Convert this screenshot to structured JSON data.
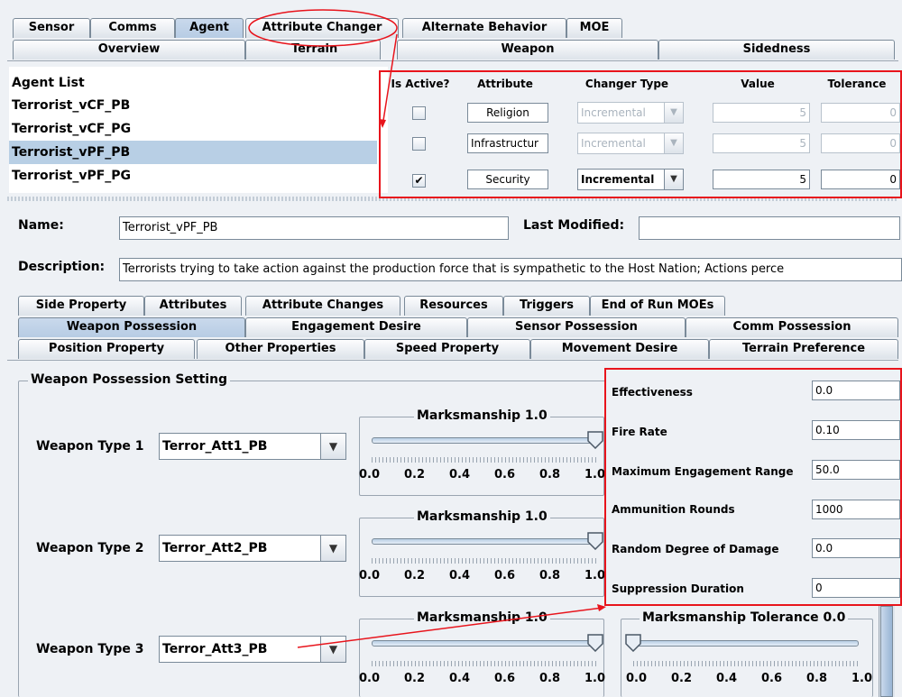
{
  "top_tabs": [
    "Sensor",
    "Comms",
    "Agent",
    "Attribute Changer",
    "Alternate Behavior",
    "MOE"
  ],
  "second_tabs": [
    "Overview",
    "Terrain",
    "Weapon",
    "Sidedness"
  ],
  "agent_list": {
    "header": "Agent List",
    "items": [
      "Terrorist_vCF_PB",
      "Terrorist_vCF_PG",
      "Terrorist_vPF_PB",
      "Terrorist_vPF_PG"
    ],
    "selected_index": 2
  },
  "attr_table": {
    "headers": [
      "Is Active?",
      "Attribute",
      "Changer Type",
      "Value",
      "Tolerance"
    ],
    "rows": [
      {
        "active": false,
        "attribute": "Religion",
        "changer": "Incremental",
        "value": "5",
        "tolerance": "0",
        "enabled": false
      },
      {
        "active": false,
        "attribute": "Infrastructur",
        "changer": "Incremental",
        "value": "5",
        "tolerance": "0",
        "enabled": false
      },
      {
        "active": true,
        "attribute": "Security",
        "changer": "Incremental",
        "value": "5",
        "tolerance": "0",
        "enabled": true
      }
    ]
  },
  "form": {
    "name_label": "Name:",
    "name_value": "Terrorist_vPF_PB",
    "modified_label": "Last Modified:",
    "modified_value": "",
    "desc_label": "Description:",
    "desc_value": "Terrorists trying to take action against the production force that is sympathetic to the Host Nation; Actions perce"
  },
  "sub_tabs_row1": [
    "Side Property",
    "Attributes",
    "Attribute Changes",
    "Resources",
    "Triggers",
    "End of Run MOEs"
  ],
  "sub_tabs_row2": [
    "Weapon Possession",
    "Engagement Desire",
    "Sensor Possession",
    "Comm Possession"
  ],
  "sub_tabs_row3": [
    "Position Property",
    "Other Properties",
    "Speed Property",
    "Movement Desire",
    "Terrain Preference"
  ],
  "weapon_section": {
    "title": "Weapon Possession Setting",
    "weapons": [
      {
        "label": "Weapon Type 1",
        "value": "Terror_Att1_PB",
        "marksmanship_title": "Marksmanship 1.0",
        "marksmanship": 1.0
      },
      {
        "label": "Weapon Type 2",
        "value": "Terror_Att2_PB",
        "marksmanship_title": "Marksmanship 1.0",
        "marksmanship": 1.0
      },
      {
        "label": "Weapon Type 3",
        "value": "Terror_Att3_PB",
        "marksmanship_title": "Marksmanship 1.0",
        "marksmanship": 1.0
      }
    ],
    "tolerance_title": "Marksmanship Tolerance 0.0",
    "tolerance": 0.0,
    "tick_labels": [
      "0.0",
      "0.2",
      "0.4",
      "0.6",
      "0.8",
      "1.0"
    ]
  },
  "properties": [
    {
      "label": "Effectiveness",
      "value": "0.0"
    },
    {
      "label": "Fire Rate",
      "value": "0.10"
    },
    {
      "label": "Maximum Engagement Range",
      "value": "50.0"
    },
    {
      "label": "Ammunition Rounds",
      "value": "1000"
    },
    {
      "label": "Random Degree of Damage",
      "value": "0.0"
    },
    {
      "label": "Suppression Duration",
      "value": "0"
    }
  ],
  "colors": {
    "annotation": "#e8141c",
    "selection": "#b8cfe5",
    "background": "#eef1f5"
  },
  "icons": {
    "combo_arrow": "chevron-down-icon",
    "check": "check-icon"
  }
}
